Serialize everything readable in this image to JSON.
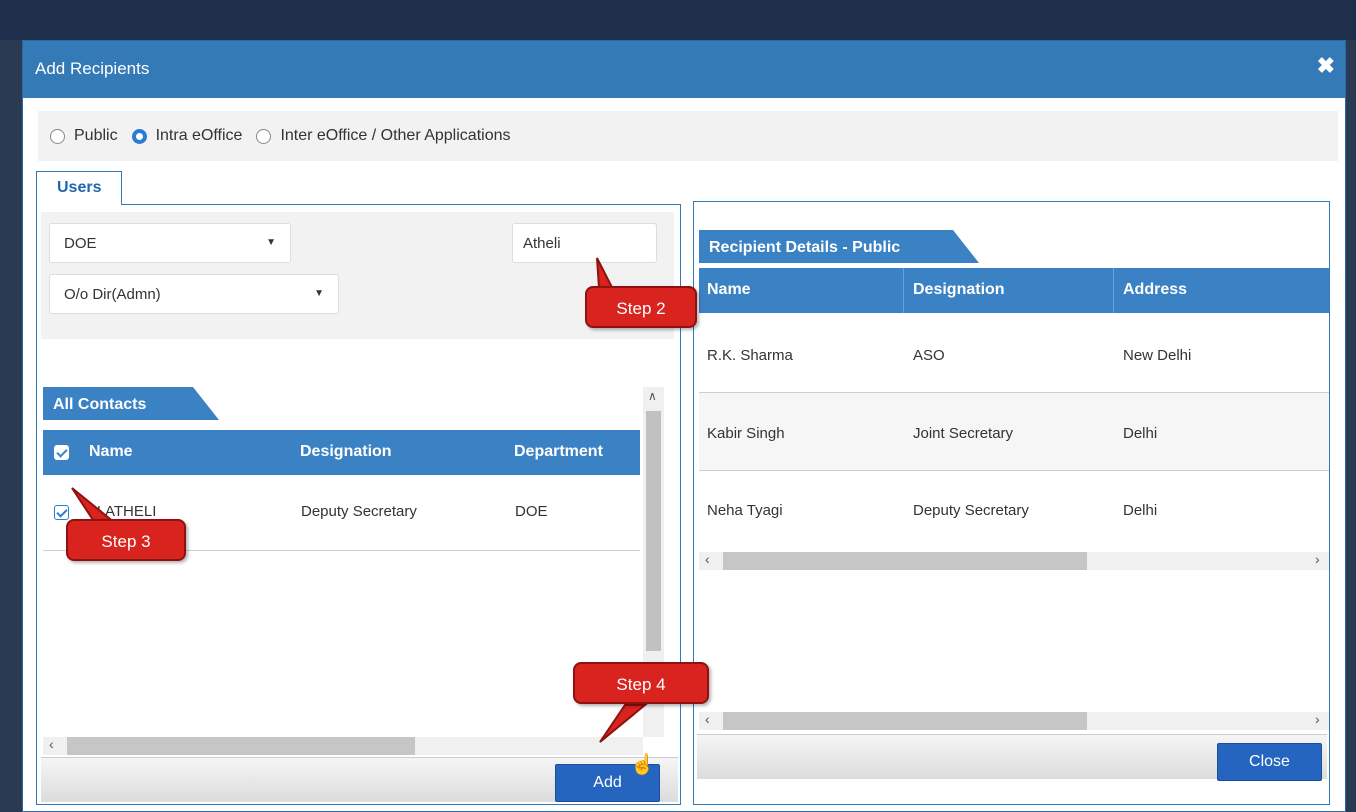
{
  "modal": {
    "title": "Add Recipients",
    "close_symbol": "✖"
  },
  "recipient_type": {
    "options": [
      {
        "label": "Public",
        "checked": false
      },
      {
        "label": "Intra eOffice",
        "checked": true
      },
      {
        "label": "Inter eOffice / Other Applications",
        "checked": false
      }
    ]
  },
  "tabs": {
    "users": "Users"
  },
  "filters": {
    "department": "DOE",
    "office": "O/o Dir(Admn)",
    "search_value": "Atheli"
  },
  "contacts": {
    "title": "All Contacts",
    "columns": [
      "Name",
      "Designation",
      "Department"
    ],
    "rows": [
      {
        "name": "H.ATHELI",
        "designation": "Deputy Secretary",
        "department": "DOE",
        "checked": true
      }
    ],
    "add_label": "Add"
  },
  "recipients": {
    "title": "Recipient Details - Public",
    "columns": [
      "Name",
      "Designation",
      "Address"
    ],
    "rows": [
      {
        "name": "R.K. Sharma",
        "designation": "ASO",
        "address": "New Delhi"
      },
      {
        "name": "Kabir Singh",
        "designation": "Joint Secretary",
        "address": "Delhi"
      },
      {
        "name": "Neha Tyagi",
        "designation": "Deputy Secretary",
        "address": "Delhi"
      }
    ],
    "close_label": "Close"
  },
  "callouts": {
    "step2": "Step 2",
    "step3": "Step 3",
    "step4": "Step 4"
  },
  "colors": {
    "header": "#337ab7",
    "accent": "#3b82c4",
    "button": "#2565c0",
    "callout": "#d9231f"
  }
}
